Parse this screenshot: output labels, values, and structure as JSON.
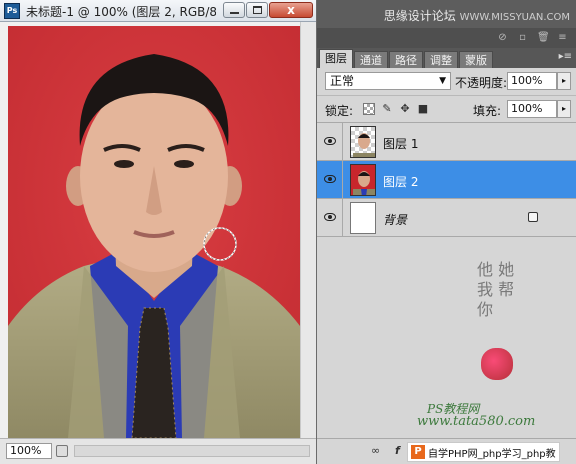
{
  "document": {
    "ps_badge": "Ps",
    "title": "未标题-1 @ 100% (图层 2, RGB/8...",
    "zoom": "100%",
    "close_label": "x"
  },
  "forum": {
    "name": "思缘设计论坛",
    "url": "WWW.MISSYUAN.COM"
  },
  "panel": {
    "tabs": [
      {
        "label": "图层",
        "active": true
      },
      {
        "label": "通道",
        "active": false
      },
      {
        "label": "路径",
        "active": false
      },
      {
        "label": "调整",
        "active": false
      },
      {
        "label": "蒙版",
        "active": false
      }
    ],
    "blend_mode": "正常",
    "opacity_label": "不透明度:",
    "opacity_value": "100%",
    "lock_label": "锁定:",
    "fill_label": "填充:",
    "fill_value": "100%",
    "layers": [
      {
        "name": "图层 1",
        "thumb": "checker",
        "selected": false
      },
      {
        "name": "图层 2",
        "thumb": "red",
        "selected": true
      },
      {
        "name": "背景",
        "thumb": "white",
        "selected": false,
        "locked": true
      }
    ]
  },
  "watermark": {
    "calligraphy": "他 她\n我 帮\n你",
    "line1": "PS教程网",
    "line2": "www.tata580.com"
  },
  "footer": {
    "site_logo": "P",
    "site_text": "自学PHP网_php学习_php教"
  },
  "colors": {
    "photo_background": "#d52f34",
    "selected_layer": "#3d8ee6",
    "panel_bg": "#d6d6d6"
  }
}
